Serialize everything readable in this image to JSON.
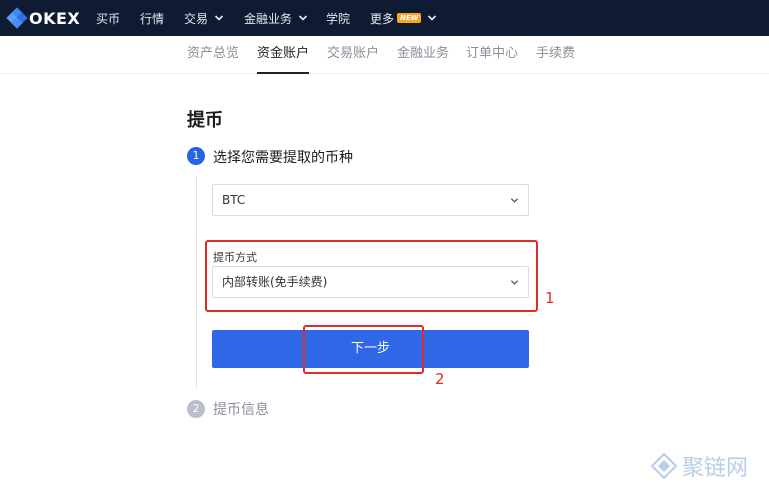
{
  "brand": {
    "name": "OKEX"
  },
  "topnav": {
    "buy": "买币",
    "market": "行情",
    "trade": "交易",
    "finance": "金融业务",
    "academy": "学院",
    "more": "更多",
    "new_badge": "NEW"
  },
  "subnav": {
    "tabs": [
      {
        "label": "资产总览",
        "active": false
      },
      {
        "label": "资金账户",
        "active": true
      },
      {
        "label": "交易账户",
        "active": false
      },
      {
        "label": "金融业务",
        "active": false
      },
      {
        "label": "订单中心",
        "active": false
      },
      {
        "label": "手续费",
        "active": false
      }
    ]
  },
  "page": {
    "title": "提币"
  },
  "steps": [
    {
      "number": "1",
      "label": "选择您需要提取的币种",
      "state": "active"
    },
    {
      "number": "2",
      "label": "提币信息",
      "state": "inactive"
    }
  ],
  "form": {
    "coin_value": "BTC",
    "method_label": "提币方式",
    "method_value": "内部转账(免手续费)",
    "next_button": "下一步"
  },
  "annotations": {
    "box1": "1",
    "box2": "2"
  },
  "watermark": {
    "text": "聚链网"
  },
  "colors": {
    "topbar_bg": "#0e1b33",
    "primary": "#2f67e6",
    "annotation": "#e22b2b"
  },
  "icons": {
    "dropdown": "chevron-down-icon",
    "logo": "okex-logo-icon"
  }
}
